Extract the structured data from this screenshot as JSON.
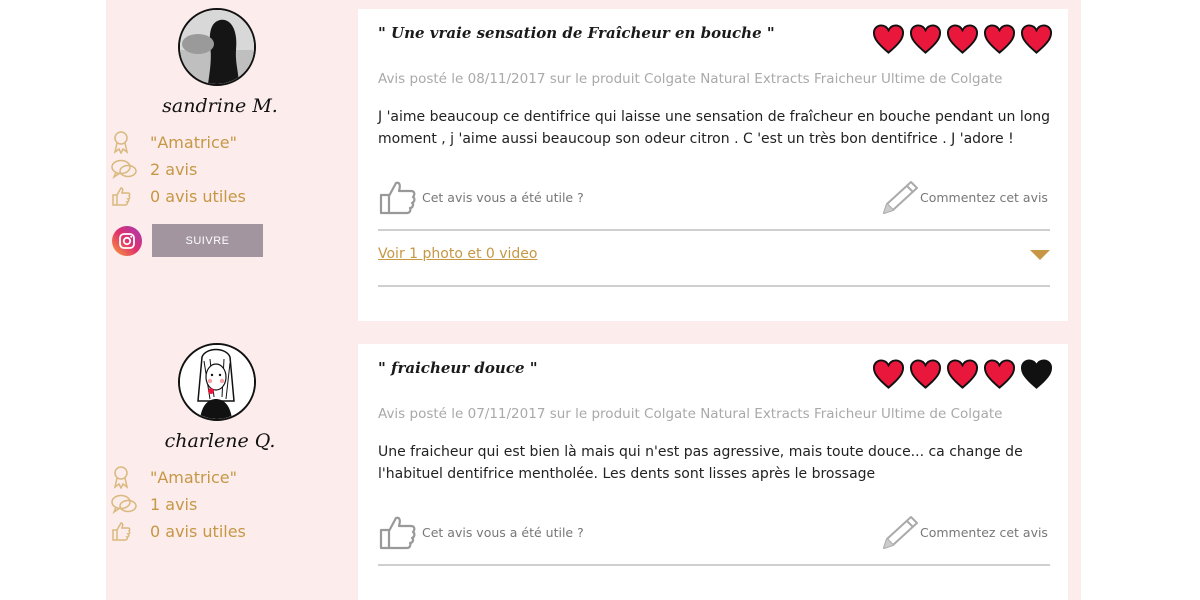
{
  "colors": {
    "accent": "#c69744",
    "heart_red": "#e8173b",
    "heart_black": "#111111",
    "panel_bg": "#fcecec",
    "follow_bg": "#a2959f"
  },
  "reviews": [
    {
      "author": "sandrine M.",
      "badge": "\"Amatrice\"",
      "review_count": "2 avis",
      "useful_count": "0 avis utiles",
      "follow_label": "SUIVRE",
      "title": "\" Une vraie sensation de Fraîcheur en bouche \"",
      "rating": 5,
      "meta": "Avis posté le 08/11/2017 sur le produit Colgate Natural Extracts Fraicheur Ultime de Colgate",
      "text": "J 'aime beaucoup ce dentifrice qui laisse une sensation de fraîcheur en bouche pendant un long moment , j 'aime aussi beaucoup son odeur citron . C 'est un très bon dentifrice . J 'adore !",
      "useful_label": "Cet avis vous a été utile ?",
      "comment_label": "Commentez cet avis",
      "media_link": "Voir 1 photo et 0 video"
    },
    {
      "author": "charlene Q.",
      "badge": "\"Amatrice\"",
      "review_count": "1 avis",
      "useful_count": "0 avis utiles",
      "title": "\" fraicheur douce \"",
      "rating": 4,
      "meta": "Avis posté le 07/11/2017 sur le produit Colgate Natural Extracts Fraicheur Ultime de Colgate",
      "text": "Une fraicheur qui est bien là mais qui n'est pas agressive, mais toute douce... ca change de l'habituel dentifrice mentholée. Les dents sont lisses après le brossage",
      "useful_label": "Cet avis vous a été utile ?",
      "comment_label": "Commentez cet avis"
    }
  ]
}
